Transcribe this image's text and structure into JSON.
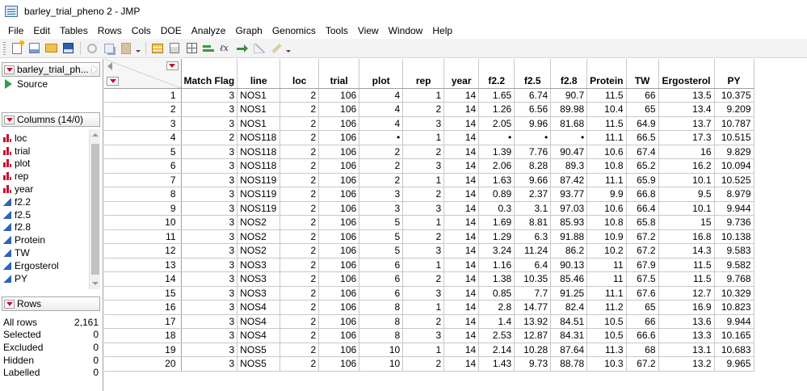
{
  "window": {
    "title": "barley_trial_pheno 2 - JMP",
    "icon": "jmp-data-table-icon"
  },
  "menu": [
    "File",
    "Edit",
    "Tables",
    "Rows",
    "Cols",
    "DOE",
    "Analyze",
    "Graph",
    "Genomics",
    "Tools",
    "View",
    "Window",
    "Help"
  ],
  "toolbar": {
    "icons": [
      "new-table-icon",
      "edit-icon",
      "open-icon",
      "save-icon",
      "cut-icon",
      "copy-icon",
      "paste-icon",
      "data-table-icon",
      "formula-icon",
      "grid-icon",
      "graph-builder-icon",
      "fx-icon",
      "run-script-icon",
      "chart-icon",
      "pencil-icon"
    ]
  },
  "left_panel": {
    "table_name": "barley_trial_ph...",
    "source_label": "Source",
    "columns_header": "Columns (14/0)",
    "columns": [
      {
        "name": "loc",
        "type": "ordinal"
      },
      {
        "name": "trial",
        "type": "ordinal"
      },
      {
        "name": "plot",
        "type": "ordinal"
      },
      {
        "name": "rep",
        "type": "ordinal"
      },
      {
        "name": "year",
        "type": "ordinal"
      },
      {
        "name": "f2.2",
        "type": "continuous"
      },
      {
        "name": "f2.5",
        "type": "continuous"
      },
      {
        "name": "f2.8",
        "type": "continuous"
      },
      {
        "name": "Protein",
        "type": "continuous"
      },
      {
        "name": "TW",
        "type": "continuous"
      },
      {
        "name": "Ergosterol",
        "type": "continuous"
      },
      {
        "name": "PY",
        "type": "continuous"
      }
    ],
    "rows_header": "Rows",
    "rows_stats": [
      {
        "label": "All rows",
        "value": "2,161"
      },
      {
        "label": "Selected",
        "value": "0"
      },
      {
        "label": "Excluded",
        "value": "0"
      },
      {
        "label": "Hidden",
        "value": "0"
      },
      {
        "label": "Labelled",
        "value": "0"
      }
    ]
  },
  "table": {
    "headers": [
      "Match Flag",
      "line",
      "loc",
      "trial",
      "plot",
      "rep",
      "year",
      "f2.2",
      "f2.5",
      "f2.8",
      "Protein",
      "TW",
      "Ergosterol",
      "PY"
    ],
    "rows": [
      [
        "1",
        "3",
        "NOS1",
        "2",
        "106",
        "4",
        "1",
        "14",
        "1.65",
        "6.74",
        "90.7",
        "11.5",
        "66",
        "13.5",
        "10.375"
      ],
      [
        "2",
        "3",
        "NOS1",
        "2",
        "106",
        "4",
        "2",
        "14",
        "1.26",
        "6.56",
        "89.98",
        "10.4",
        "65",
        "13.4",
        "9.209"
      ],
      [
        "3",
        "3",
        "NOS1",
        "2",
        "106",
        "4",
        "3",
        "14",
        "2.05",
        "9.96",
        "81.68",
        "11.5",
        "64.9",
        "13.7",
        "10.787"
      ],
      [
        "4",
        "2",
        "NOS118",
        "2",
        "106",
        "•",
        "1",
        "14",
        "•",
        "•",
        "•",
        "11.1",
        "66.5",
        "17.3",
        "10.515"
      ],
      [
        "5",
        "3",
        "NOS118",
        "2",
        "106",
        "2",
        "2",
        "14",
        "1.39",
        "7.76",
        "90.47",
        "10.6",
        "67.4",
        "16",
        "9.829"
      ],
      [
        "6",
        "3",
        "NOS118",
        "2",
        "106",
        "2",
        "3",
        "14",
        "2.06",
        "8.28",
        "89.3",
        "10.8",
        "65.2",
        "16.2",
        "10.094"
      ],
      [
        "7",
        "3",
        "NOS119",
        "2",
        "106",
        "2",
        "1",
        "14",
        "1.63",
        "9.66",
        "87.42",
        "11.1",
        "65.9",
        "10.1",
        "10.525"
      ],
      [
        "8",
        "3",
        "NOS119",
        "2",
        "106",
        "3",
        "2",
        "14",
        "0.89",
        "2.37",
        "93.77",
        "9.9",
        "66.8",
        "9.5",
        "8.979"
      ],
      [
        "9",
        "3",
        "NOS119",
        "2",
        "106",
        "3",
        "3",
        "14",
        "0.3",
        "3.1",
        "97.03",
        "10.6",
        "66.4",
        "10.1",
        "9.944"
      ],
      [
        "10",
        "3",
        "NOS2",
        "2",
        "106",
        "5",
        "1",
        "14",
        "1.69",
        "8.81",
        "85.93",
        "10.8",
        "65.8",
        "15",
        "9.736"
      ],
      [
        "11",
        "3",
        "NOS2",
        "2",
        "106",
        "5",
        "2",
        "14",
        "1.29",
        "6.3",
        "91.88",
        "10.9",
        "67.2",
        "16.8",
        "10.138"
      ],
      [
        "12",
        "3",
        "NOS2",
        "2",
        "106",
        "5",
        "3",
        "14",
        "3.24",
        "11.24",
        "86.2",
        "10.2",
        "67.2",
        "14.3",
        "9.583"
      ],
      [
        "13",
        "3",
        "NOS3",
        "2",
        "106",
        "6",
        "1",
        "14",
        "1.16",
        "6.4",
        "90.13",
        "11",
        "67.9",
        "11.5",
        "9.582"
      ],
      [
        "14",
        "3",
        "NOS3",
        "2",
        "106",
        "6",
        "2",
        "14",
        "1.38",
        "10.35",
        "85.46",
        "11",
        "67.5",
        "11.5",
        "9.768"
      ],
      [
        "15",
        "3",
        "NOS3",
        "2",
        "106",
        "6",
        "3",
        "14",
        "0.85",
        "7.7",
        "91.25",
        "11.1",
        "67.6",
        "12.7",
        "10.329"
      ],
      [
        "16",
        "3",
        "NOS4",
        "2",
        "106",
        "8",
        "1",
        "14",
        "2.8",
        "14.77",
        "82.4",
        "11.2",
        "65",
        "16.9",
        "10.823"
      ],
      [
        "17",
        "3",
        "NOS4",
        "2",
        "106",
        "8",
        "2",
        "14",
        "1.4",
        "13.92",
        "84.51",
        "10.5",
        "66",
        "13.6",
        "9.944"
      ],
      [
        "18",
        "3",
        "NOS4",
        "2",
        "106",
        "8",
        "3",
        "14",
        "2.53",
        "12.87",
        "84.31",
        "10.5",
        "66.6",
        "13.3",
        "10.165"
      ],
      [
        "19",
        "3",
        "NOS5",
        "2",
        "106",
        "10",
        "1",
        "14",
        "2.14",
        "10.28",
        "87.64",
        "11.3",
        "68",
        "13.1",
        "10.683"
      ],
      [
        "20",
        "3",
        "NOS5",
        "2",
        "106",
        "10",
        "2",
        "14",
        "1.43",
        "9.73",
        "88.78",
        "10.3",
        "67.2",
        "13.2",
        "9.965"
      ]
    ]
  }
}
